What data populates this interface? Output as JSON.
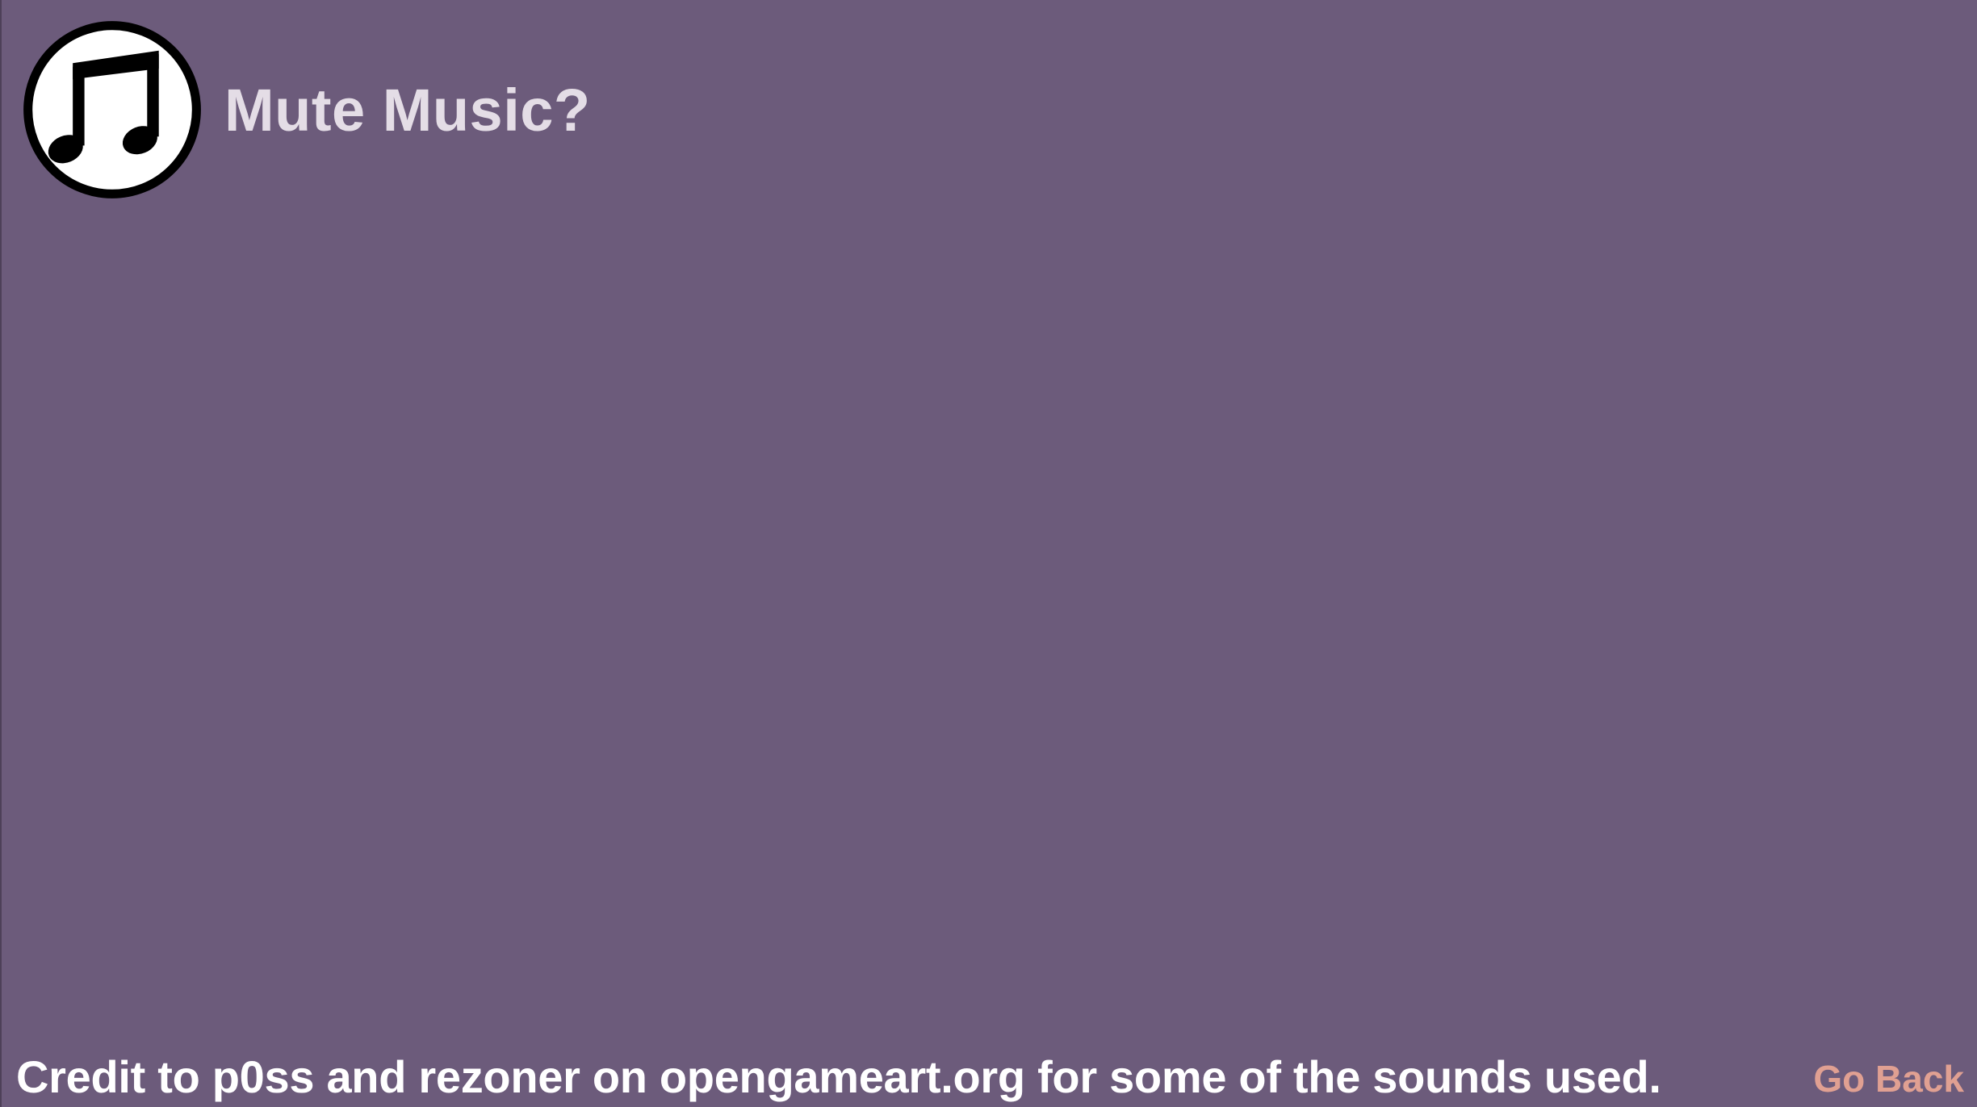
{
  "screen": {
    "background_color": "#6c5b7b"
  },
  "music_toggle": {
    "icon": "music-note-icon",
    "label": "Mute Music?"
  },
  "footer": {
    "credit": "Credit to p0ss and rezoner on opengameart.org for some of the sounds used.",
    "go_back_label": "Go Back",
    "go_back_color": "#e0a092"
  }
}
